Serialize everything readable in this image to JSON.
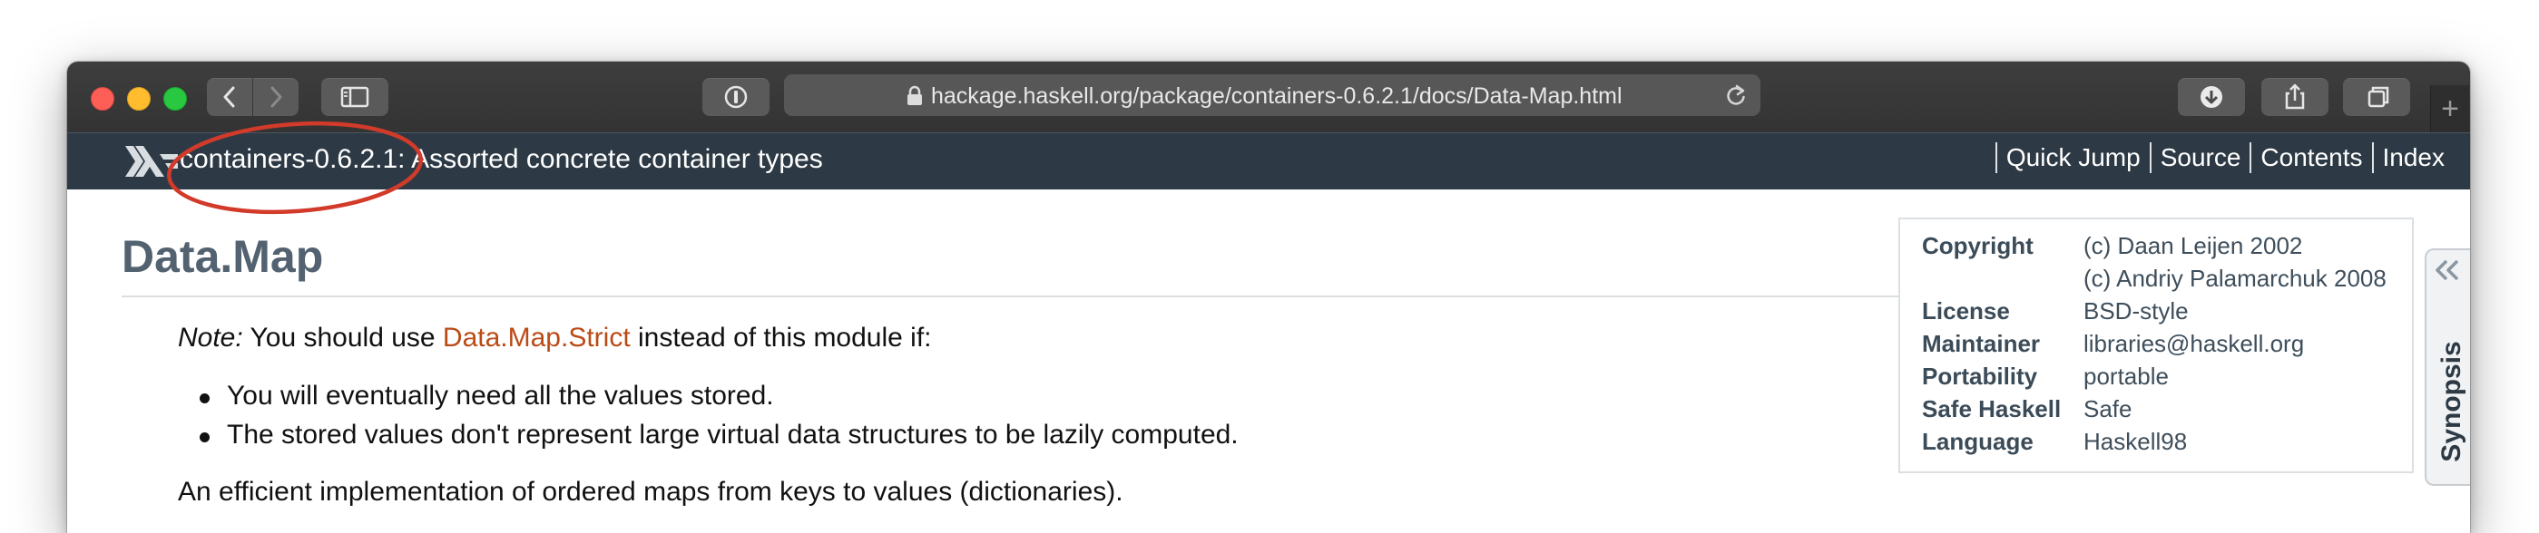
{
  "browser": {
    "url": "hackage.haskell.org/package/containers-0.6.2.1/docs/Data-Map.html",
    "new_tab_label": "+"
  },
  "header": {
    "title": "containers-0.6.2.1: Assorted concrete container types",
    "nav": [
      "Quick Jump",
      "Source",
      "Contents",
      "Index"
    ]
  },
  "module": {
    "title": "Data.Map",
    "note_label": "Note:",
    "note_before": " You should use ",
    "note_link": "Data.Map.Strict",
    "note_after": " instead of this module if:",
    "bullets": [
      "You will eventually need all the values stored.",
      "The stored values don't represent large virtual data structures to be lazily computed."
    ],
    "paragraph": "An efficient implementation of ordered maps from keys to values (dictionaries)."
  },
  "info": {
    "copyright_label": "Copyright",
    "copyright_1": "(c) Daan Leijen 2002",
    "copyright_2": "(c) Andriy Palamarchuk 2008",
    "license_label": "License",
    "license": "BSD-style",
    "maintainer_label": "Maintainer",
    "maintainer": "libraries@haskell.org",
    "portability_label": "Portability",
    "portability": "portable",
    "safe_label": "Safe Haskell",
    "safe": "Safe",
    "language_label": "Language",
    "language": "Haskell98"
  },
  "synopsis": {
    "label": "Synopsis"
  },
  "colors": {
    "header_bg": "#2d3a45",
    "link": "#ba4b15",
    "annotation": "#d23a2a",
    "module_title": "#526270"
  }
}
